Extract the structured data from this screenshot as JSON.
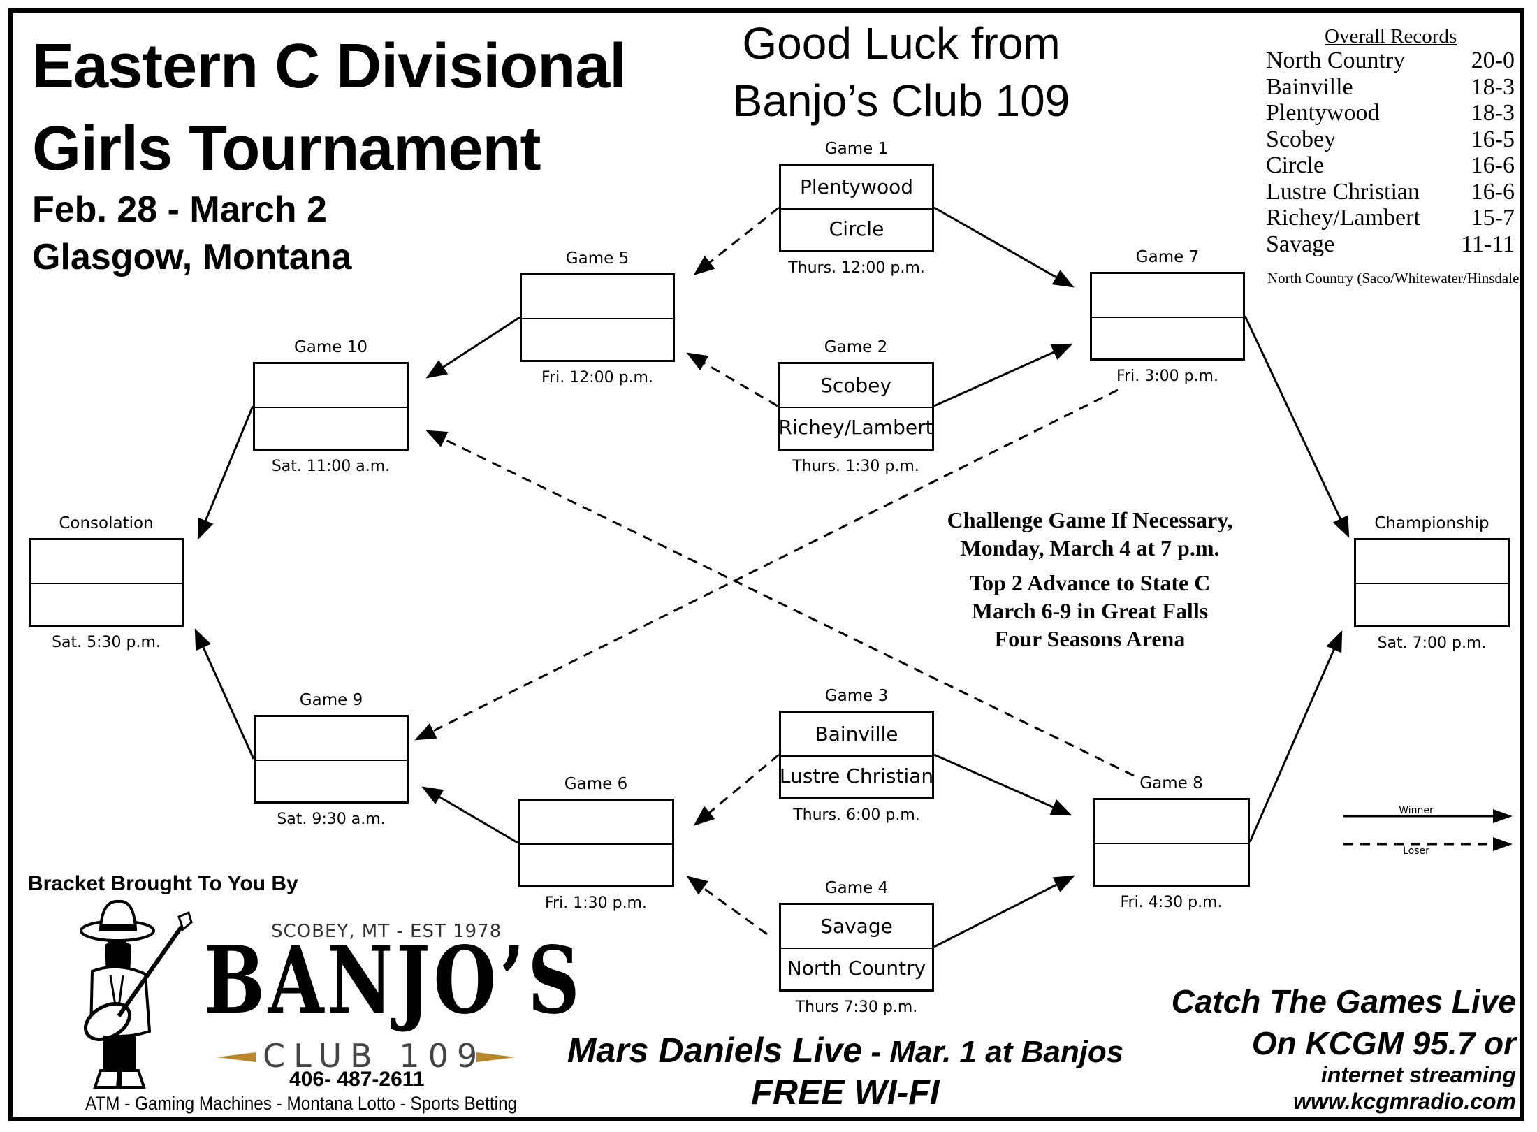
{
  "header": {
    "title_line1": "Eastern C Divisional",
    "title_line2": "Girls Tournament",
    "dates": "Feb. 28 - March 2",
    "location": "Glasgow, Montana",
    "good_luck_line1": "Good Luck from",
    "good_luck_line2": "Banjo’s Club 109"
  },
  "records": {
    "heading": "Overall Records",
    "rows": [
      {
        "team": "North Country",
        "record": "20-0"
      },
      {
        "team": "Bainville",
        "record": "18-3"
      },
      {
        "team": "Plentywood",
        "record": "18-3"
      },
      {
        "team": "Scobey",
        "record": "16-5"
      },
      {
        "team": "Circle",
        "record": "16-6"
      },
      {
        "team": "Lustre Christian",
        "record": "16-6"
      },
      {
        "team": "Richey/Lambert",
        "record": "15-7"
      },
      {
        "team": "Savage",
        "record": "11-11"
      }
    ],
    "note": "North Country (Saco/Whitewater/Hinsdale)"
  },
  "games": {
    "g1": {
      "label": "Game 1",
      "top": "Plentywood",
      "bottom": "Circle",
      "time": "Thurs. 12:00 p.m."
    },
    "g2": {
      "label": "Game 2",
      "top": "Scobey",
      "bottom": "Richey/Lambert",
      "time": "Thurs. 1:30 p.m."
    },
    "g3": {
      "label": "Game 3",
      "top": "Bainville",
      "bottom": "Lustre Christian",
      "time": "Thurs. 6:00 p.m."
    },
    "g4": {
      "label": "Game 4",
      "top": "Savage",
      "bottom": "North Country",
      "time": "Thurs  7:30 p.m."
    },
    "g5": {
      "label": "Game 5",
      "top": "",
      "bottom": "",
      "time": "Fri. 12:00 p.m."
    },
    "g6": {
      "label": "Game 6",
      "top": "",
      "bottom": "",
      "time": "Fri. 1:30 p.m."
    },
    "g7": {
      "label": "Game 7",
      "top": "",
      "bottom": "",
      "time": "Fri. 3:00 p.m."
    },
    "g8": {
      "label": "Game 8",
      "top": "",
      "bottom": "",
      "time": "Fri. 4:30 p.m."
    },
    "g9": {
      "label": "Game 9",
      "top": "",
      "bottom": "",
      "time": "Sat. 9:30 a.m."
    },
    "g10": {
      "label": "Game 10",
      "top": "",
      "bottom": "",
      "time": "Sat. 11:00 a.m."
    },
    "consolation": {
      "label": "Consolation",
      "top": "",
      "bottom": "",
      "time": "Sat. 5:30 p.m."
    },
    "championship": {
      "label": "Championship",
      "top": "",
      "bottom": "",
      "time": "Sat. 7:00 p.m."
    }
  },
  "connections": [
    {
      "from": "g1",
      "to": "g7",
      "type": "winner"
    },
    {
      "from": "g1",
      "to": "g5",
      "type": "loser"
    },
    {
      "from": "g2",
      "to": "g7",
      "type": "winner"
    },
    {
      "from": "g2",
      "to": "g5",
      "type": "loser"
    },
    {
      "from": "g3",
      "to": "g8",
      "type": "winner"
    },
    {
      "from": "g3",
      "to": "g6",
      "type": "loser"
    },
    {
      "from": "g4",
      "to": "g8",
      "type": "winner"
    },
    {
      "from": "g4",
      "to": "g6",
      "type": "loser"
    },
    {
      "from": "g5",
      "to": "g10",
      "type": "winner"
    },
    {
      "from": "g6",
      "to": "g9",
      "type": "winner"
    },
    {
      "from": "g7",
      "to": "championship",
      "type": "winner"
    },
    {
      "from": "g7",
      "to": "g9",
      "type": "loser"
    },
    {
      "from": "g8",
      "to": "championship",
      "type": "winner"
    },
    {
      "from": "g8",
      "to": "g10",
      "type": "loser"
    },
    {
      "from": "g10",
      "to": "consolation",
      "type": "winner"
    },
    {
      "from": "g9",
      "to": "consolation",
      "type": "winner"
    }
  ],
  "challenge": {
    "line1": "Challenge Game If Necessary,",
    "line2": "Monday, March 4 at 7 p.m.",
    "line3": "Top 2 Advance to State C",
    "line4": "March 6-9 in Great Falls",
    "line5": "Four Seasons Arena"
  },
  "legend": {
    "winner": "Winner",
    "loser": "Loser"
  },
  "sponsor": {
    "heading": "Bracket Brought To You By",
    "tagline": "SCOBEY, MT - EST 1978",
    "name": "BANJO’S",
    "club": "CLUB 109",
    "phone": "406- 487-2611",
    "services": "ATM - Gaming Machines - Montana Lotto -  Sports Betting",
    "accent_color": "#b8862b",
    "mascot_icon": "banjo-player-icon"
  },
  "promo": {
    "line1_bold": "Mars Daniels Live",
    "line1_rest": " - Mar. 1 at Banjos",
    "line2": "FREE WI-FI"
  },
  "radio": {
    "line1": "Catch The Games Live",
    "line2": "On KCGM 95.7 or",
    "line3": "internet streaming",
    "line4": "www.kcgmradio.com"
  }
}
